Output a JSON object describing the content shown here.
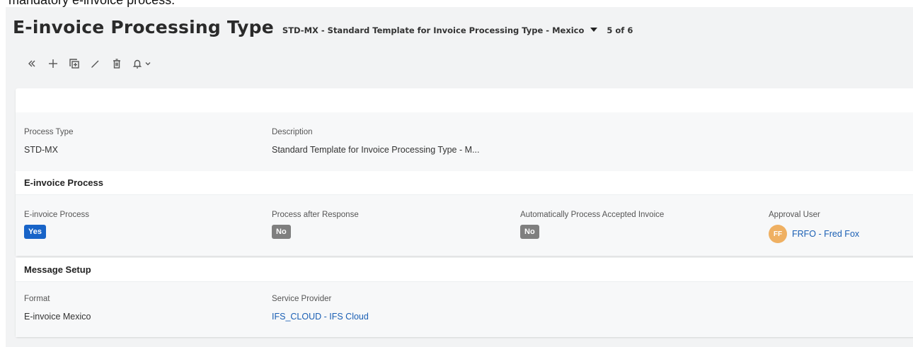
{
  "intro": {
    "text": "mandatory e-invoice process."
  },
  "header": {
    "title": "E-invoice Processing Type",
    "record_selector": "STD-MX - Standard Template for Invoice Processing Type - Mexico",
    "record_counter": "5 of 6"
  },
  "toolbar": {
    "icons": [
      "double-chevron-left-icon",
      "plus-icon",
      "duplicate-icon",
      "pencil-icon",
      "trash-icon",
      "bell-icon",
      "chevron-down-icon"
    ]
  },
  "general": {
    "process_type_label": "Process Type",
    "process_type_value": "STD-MX",
    "description_label": "Description",
    "description_value": "Standard Template for Invoice Processing Type - M..."
  },
  "einvoice_process": {
    "header": "E-invoice Process",
    "einvoice_process_label": "E-invoice Process",
    "einvoice_process_value": "Yes",
    "process_after_response_label": "Process after Response",
    "process_after_response_value": "No",
    "auto_process_label": "Automatically Process Accepted Invoice",
    "auto_process_value": "No",
    "approval_user_label": "Approval User",
    "approval_user_initials": "FF",
    "approval_user_value": "FRFO - Fred Fox"
  },
  "message_setup": {
    "header": "Message Setup",
    "format_label": "Format",
    "format_value": "E-invoice Mexico",
    "service_provider_label": "Service Provider",
    "service_provider_value": "IFS_CLOUD - IFS Cloud"
  },
  "colors": {
    "yes_badge": "#1864c8",
    "no_badge": "#7f7f7f",
    "link": "#1a5fb4",
    "avatar": "#efb062",
    "page_background": "#f2f3f4"
  }
}
